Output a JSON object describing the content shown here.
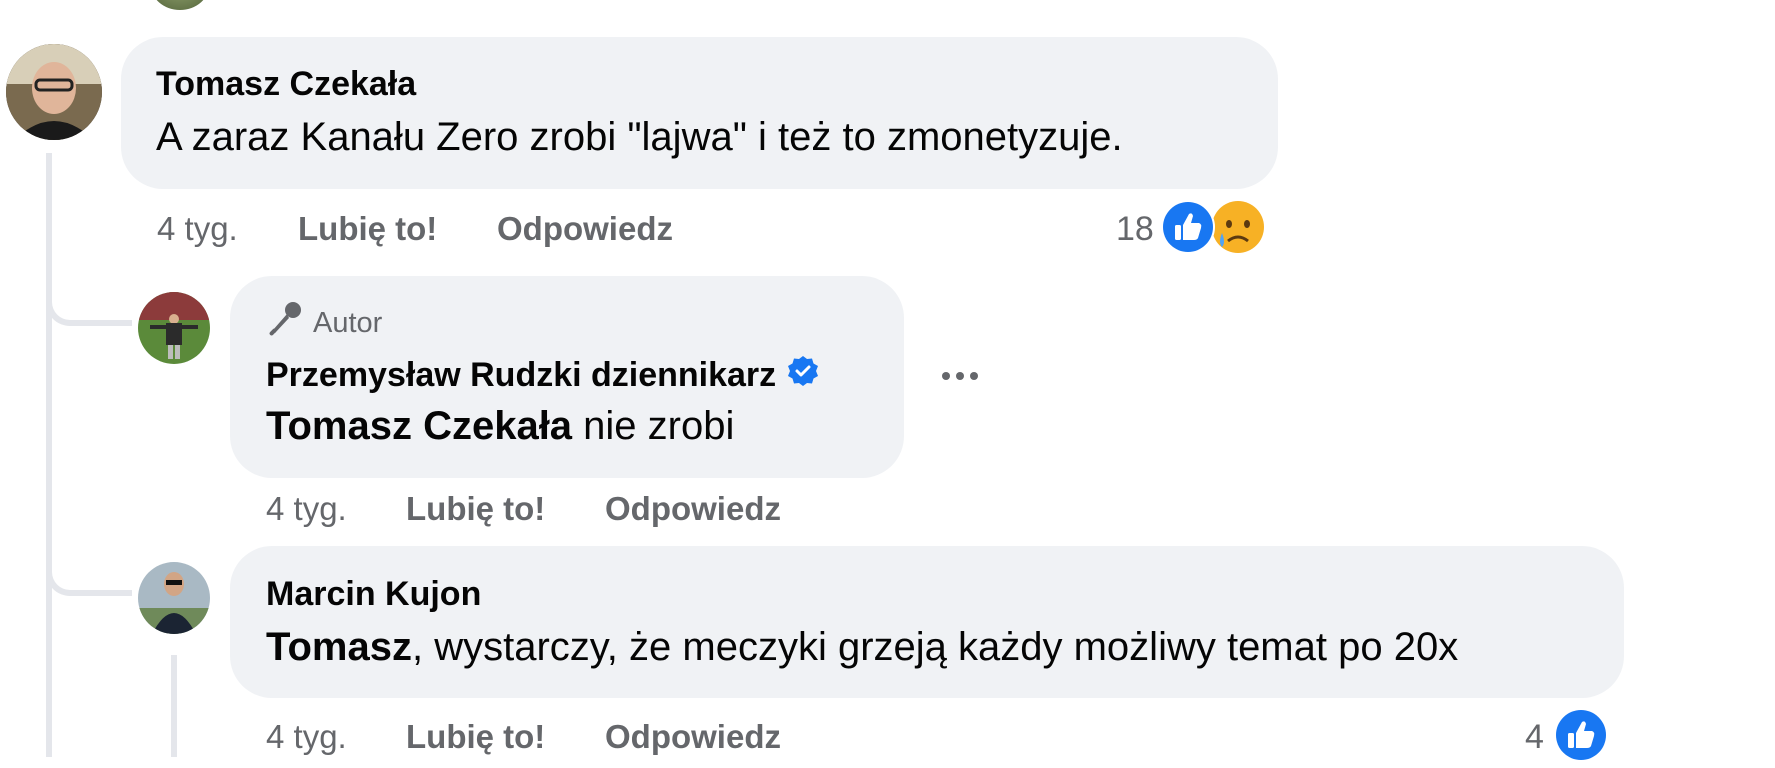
{
  "comments": [
    {
      "author": "Tomasz Czekała",
      "text": "A zaraz Kanału Zero zrobi \"lajwa\" i też to zmonetyzuje.",
      "time": "4 tyg.",
      "like_label": "Lubię to!",
      "reply_label": "Odpowiedz",
      "reaction_count": "18",
      "reactions": [
        "like-icon",
        "sad-icon"
      ]
    }
  ],
  "replies": [
    {
      "badge": "Autor",
      "author": "Przemysław Rudzki dziennikarz",
      "verified": true,
      "mention": "Tomasz Czekała",
      "text": " nie zrobi",
      "time": "4 tyg.",
      "like_label": "Lubię to!",
      "reply_label": "Odpowiedz"
    },
    {
      "author": "Marcin Kujon",
      "mention": "Tomasz",
      "text": ", wystarczy, że meczyki grzeją każdy możliwy temat po 20x",
      "time": "4 tyg.",
      "like_label": "Lubię to!",
      "reply_label": "Odpowiedz",
      "reaction_count": "4",
      "reactions": [
        "like-icon"
      ]
    }
  ],
  "colors": {
    "bubble": "#f0f2f5",
    "meta_text": "#65676b",
    "like_blue": "#1877f2",
    "verified_blue": "#1877f2",
    "thread_line": "#e4e6eb"
  }
}
